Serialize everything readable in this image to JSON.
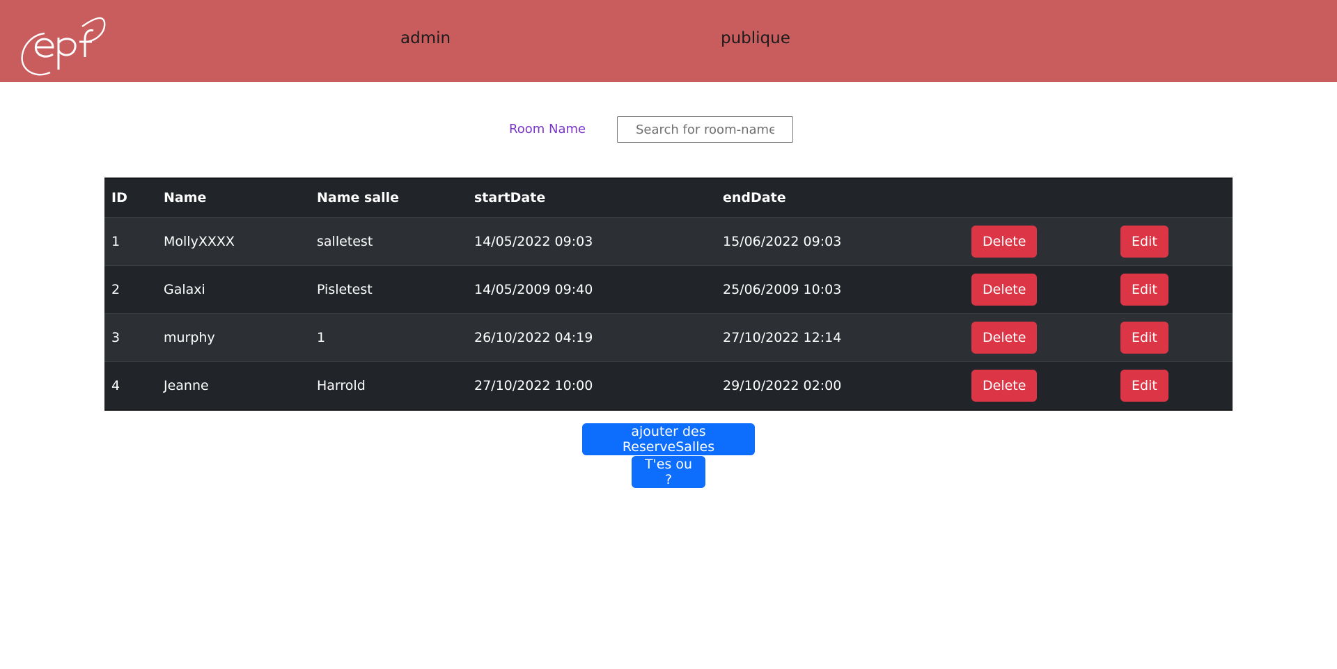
{
  "header": {
    "logo_text": "epf",
    "nav": [
      {
        "label": "admin"
      },
      {
        "label": "publique"
      }
    ]
  },
  "search": {
    "label": "Room Name",
    "placeholder": "Search for room-names",
    "value": ""
  },
  "table": {
    "columns": [
      "ID",
      "Name",
      "Name salle",
      "startDate",
      "endDate",
      "",
      ""
    ],
    "rows": [
      {
        "id": "1",
        "name": "MollyXXXX",
        "salle": "salletest",
        "start": "14/05/2022 09:03",
        "end": "15/06/2022 09:03",
        "delete": "Delete",
        "edit": "Edit"
      },
      {
        "id": "2",
        "name": "Galaxi",
        "salle": "Pisletest",
        "start": "14/05/2009 09:40",
        "end": "25/06/2009 10:03",
        "delete": "Delete",
        "edit": "Edit"
      },
      {
        "id": "3",
        "name": "murphy",
        "salle": "1",
        "start": "26/10/2022 04:19",
        "end": "27/10/2022 12:14",
        "delete": "Delete",
        "edit": "Edit"
      },
      {
        "id": "4",
        "name": "Jeanne",
        "salle": "Harrold",
        "start": "27/10/2022 10:00",
        "end": "29/10/2022 02:00",
        "delete": "Delete",
        "edit": "Edit"
      }
    ]
  },
  "actions": {
    "add_label": "ajouter des ReserveSalles",
    "where_label": "T'es ou ?"
  },
  "colors": {
    "header_bg": "#c95c5c",
    "table_bg": "#212529",
    "danger": "#dc3545",
    "primary": "#0d6efd",
    "label_purple": "#7a35c9"
  }
}
